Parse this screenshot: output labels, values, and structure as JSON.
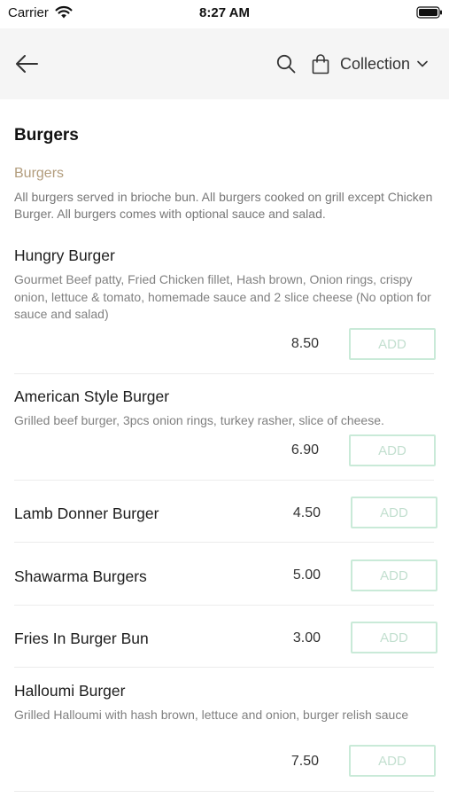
{
  "status_bar": {
    "carrier": "Carrier",
    "time": "8:27 AM"
  },
  "header": {
    "collection_label": "Collection"
  },
  "section": {
    "title": "Burgers",
    "category_name": "Burgers",
    "category_description": "All burgers served in brioche bun. All burgers cooked on grill except Chicken Burger. All burgers comes with optional sauce and salad."
  },
  "items": [
    {
      "name": "Hungry Burger",
      "description": "Gourmet Beef patty, Fried Chicken fillet, Hash brown, Onion rings, crispy onion, lettuce & tomato, homemade sauce and 2 slice cheese (No option for sauce and salad)",
      "price": "8.50",
      "add_label": "ADD"
    },
    {
      "name": "American Style Burger",
      "description": "Grilled beef burger, 3pcs onion rings, turkey rasher, slice of cheese.",
      "price": "6.90",
      "add_label": "ADD"
    },
    {
      "name": "Lamb Donner Burger",
      "description": "",
      "price": "4.50",
      "add_label": "ADD"
    },
    {
      "name": "Shawarma Burgers",
      "description": "",
      "price": "5.00",
      "add_label": "ADD"
    },
    {
      "name": "Fries In Burger Bun",
      "description": "",
      "price": "3.00",
      "add_label": "ADD"
    },
    {
      "name": "Halloumi Burger",
      "description": "Grilled Halloumi with hash brown, lettuce and onion, burger relish sauce",
      "price": "7.50",
      "add_label": "ADD"
    }
  ],
  "colors": {
    "accent_category": "#b29c7c",
    "add_border": "#c9ead8",
    "nav_bg": "#f5f5f5"
  }
}
